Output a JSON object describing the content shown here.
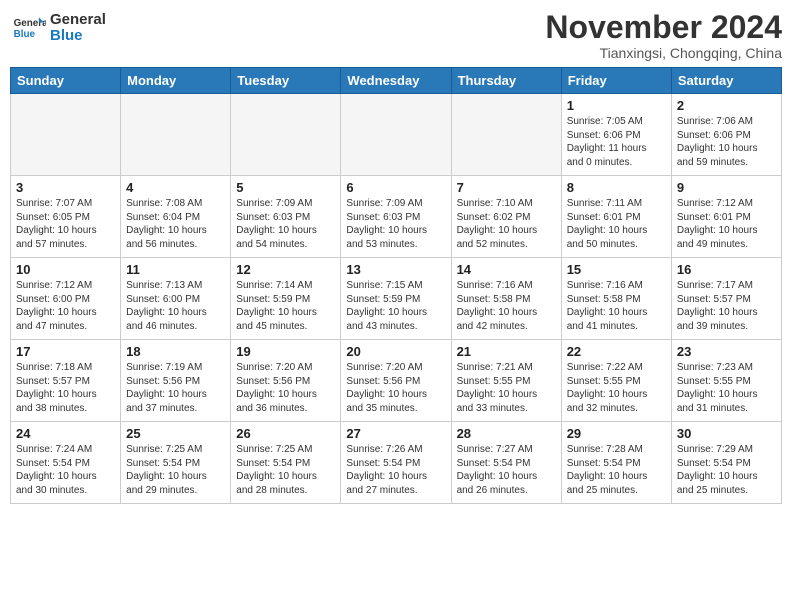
{
  "header": {
    "logo_general": "General",
    "logo_blue": "Blue",
    "month_title": "November 2024",
    "location": "Tianxingsi, Chongqing, China"
  },
  "weekdays": [
    "Sunday",
    "Monday",
    "Tuesday",
    "Wednesday",
    "Thursday",
    "Friday",
    "Saturday"
  ],
  "weeks": [
    [
      {
        "day": "",
        "info": ""
      },
      {
        "day": "",
        "info": ""
      },
      {
        "day": "",
        "info": ""
      },
      {
        "day": "",
        "info": ""
      },
      {
        "day": "",
        "info": ""
      },
      {
        "day": "1",
        "info": "Sunrise: 7:05 AM\nSunset: 6:06 PM\nDaylight: 11 hours\nand 0 minutes."
      },
      {
        "day": "2",
        "info": "Sunrise: 7:06 AM\nSunset: 6:06 PM\nDaylight: 10 hours\nand 59 minutes."
      }
    ],
    [
      {
        "day": "3",
        "info": "Sunrise: 7:07 AM\nSunset: 6:05 PM\nDaylight: 10 hours\nand 57 minutes."
      },
      {
        "day": "4",
        "info": "Sunrise: 7:08 AM\nSunset: 6:04 PM\nDaylight: 10 hours\nand 56 minutes."
      },
      {
        "day": "5",
        "info": "Sunrise: 7:09 AM\nSunset: 6:03 PM\nDaylight: 10 hours\nand 54 minutes."
      },
      {
        "day": "6",
        "info": "Sunrise: 7:09 AM\nSunset: 6:03 PM\nDaylight: 10 hours\nand 53 minutes."
      },
      {
        "day": "7",
        "info": "Sunrise: 7:10 AM\nSunset: 6:02 PM\nDaylight: 10 hours\nand 52 minutes."
      },
      {
        "day": "8",
        "info": "Sunrise: 7:11 AM\nSunset: 6:01 PM\nDaylight: 10 hours\nand 50 minutes."
      },
      {
        "day": "9",
        "info": "Sunrise: 7:12 AM\nSunset: 6:01 PM\nDaylight: 10 hours\nand 49 minutes."
      }
    ],
    [
      {
        "day": "10",
        "info": "Sunrise: 7:12 AM\nSunset: 6:00 PM\nDaylight: 10 hours\nand 47 minutes."
      },
      {
        "day": "11",
        "info": "Sunrise: 7:13 AM\nSunset: 6:00 PM\nDaylight: 10 hours\nand 46 minutes."
      },
      {
        "day": "12",
        "info": "Sunrise: 7:14 AM\nSunset: 5:59 PM\nDaylight: 10 hours\nand 45 minutes."
      },
      {
        "day": "13",
        "info": "Sunrise: 7:15 AM\nSunset: 5:59 PM\nDaylight: 10 hours\nand 43 minutes."
      },
      {
        "day": "14",
        "info": "Sunrise: 7:16 AM\nSunset: 5:58 PM\nDaylight: 10 hours\nand 42 minutes."
      },
      {
        "day": "15",
        "info": "Sunrise: 7:16 AM\nSunset: 5:58 PM\nDaylight: 10 hours\nand 41 minutes."
      },
      {
        "day": "16",
        "info": "Sunrise: 7:17 AM\nSunset: 5:57 PM\nDaylight: 10 hours\nand 39 minutes."
      }
    ],
    [
      {
        "day": "17",
        "info": "Sunrise: 7:18 AM\nSunset: 5:57 PM\nDaylight: 10 hours\nand 38 minutes."
      },
      {
        "day": "18",
        "info": "Sunrise: 7:19 AM\nSunset: 5:56 PM\nDaylight: 10 hours\nand 37 minutes."
      },
      {
        "day": "19",
        "info": "Sunrise: 7:20 AM\nSunset: 5:56 PM\nDaylight: 10 hours\nand 36 minutes."
      },
      {
        "day": "20",
        "info": "Sunrise: 7:20 AM\nSunset: 5:56 PM\nDaylight: 10 hours\nand 35 minutes."
      },
      {
        "day": "21",
        "info": "Sunrise: 7:21 AM\nSunset: 5:55 PM\nDaylight: 10 hours\nand 33 minutes."
      },
      {
        "day": "22",
        "info": "Sunrise: 7:22 AM\nSunset: 5:55 PM\nDaylight: 10 hours\nand 32 minutes."
      },
      {
        "day": "23",
        "info": "Sunrise: 7:23 AM\nSunset: 5:55 PM\nDaylight: 10 hours\nand 31 minutes."
      }
    ],
    [
      {
        "day": "24",
        "info": "Sunrise: 7:24 AM\nSunset: 5:54 PM\nDaylight: 10 hours\nand 30 minutes."
      },
      {
        "day": "25",
        "info": "Sunrise: 7:25 AM\nSunset: 5:54 PM\nDaylight: 10 hours\nand 29 minutes."
      },
      {
        "day": "26",
        "info": "Sunrise: 7:25 AM\nSunset: 5:54 PM\nDaylight: 10 hours\nand 28 minutes."
      },
      {
        "day": "27",
        "info": "Sunrise: 7:26 AM\nSunset: 5:54 PM\nDaylight: 10 hours\nand 27 minutes."
      },
      {
        "day": "28",
        "info": "Sunrise: 7:27 AM\nSunset: 5:54 PM\nDaylight: 10 hours\nand 26 minutes."
      },
      {
        "day": "29",
        "info": "Sunrise: 7:28 AM\nSunset: 5:54 PM\nDaylight: 10 hours\nand 25 minutes."
      },
      {
        "day": "30",
        "info": "Sunrise: 7:29 AM\nSunset: 5:54 PM\nDaylight: 10 hours\nand 25 minutes."
      }
    ]
  ]
}
